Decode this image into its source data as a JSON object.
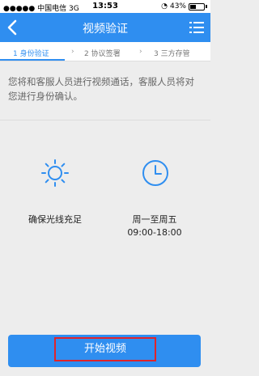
{
  "status_bar": {
    "carrier": "●●●●● 中国电信  3G",
    "time": "13:53",
    "battery_text": "43%",
    "battery_level": 0.43
  },
  "nav": {
    "title": "视频验证"
  },
  "steps": [
    {
      "label": "1 身份验证",
      "active": true
    },
    {
      "label": "2 协议签署",
      "active": false
    },
    {
      "label": "3 三方存管",
      "active": false
    }
  ],
  "intro_text": "您将和客服人员进行视频通话，客服人员将对您进行身份确认。",
  "tips": [
    {
      "icon": "sun-icon",
      "label": "确保光线充足"
    },
    {
      "icon": "clock-icon",
      "label": "周一至周五\n09:00-18:00"
    }
  ],
  "start_button_label": "开始视频",
  "colors": {
    "primary": "#2f8ef0",
    "highlight_border": "#e0242a"
  }
}
